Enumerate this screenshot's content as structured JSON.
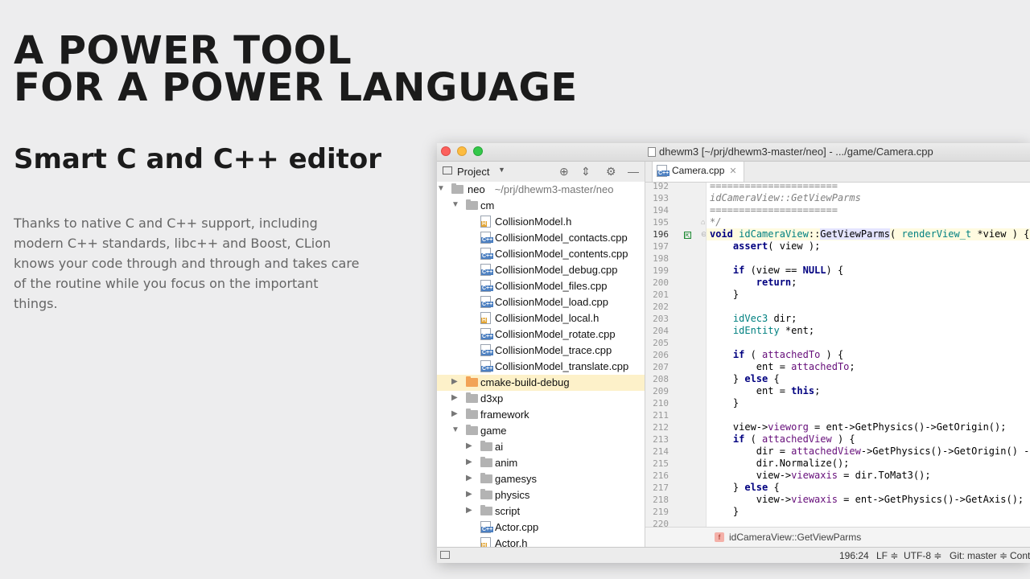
{
  "hero": {
    "line1": "A POWER TOOL",
    "line2": "FOR A POWER LANGUAGE",
    "subtitle": "Smart C and C++ editor",
    "description": "Thanks to native C and C++ support, including modern C++ standards, libc++ and Boost, CLion knows your code through and through and takes care of the routine while you focus on the important things."
  },
  "window": {
    "title": "dhewm3 [~/prj/dhewm3-master/neo] - .../game/Camera.cpp"
  },
  "project_panel": {
    "label": "Project",
    "tools": [
      "target-icon",
      "collapse-icon",
      "gear-icon",
      "minimize-icon"
    ]
  },
  "tree": {
    "root": {
      "name": "neo",
      "path": "~/prj/dhewm3-master/neo"
    },
    "items": [
      {
        "label": "cm",
        "kind": "folder",
        "expanded": true
      },
      {
        "label": "CollisionModel.h",
        "kind": "h"
      },
      {
        "label": "CollisionModel_contacts.cpp",
        "kind": "cpp"
      },
      {
        "label": "CollisionModel_contents.cpp",
        "kind": "cpp"
      },
      {
        "label": "CollisionModel_debug.cpp",
        "kind": "cpp"
      },
      {
        "label": "CollisionModel_files.cpp",
        "kind": "cpp"
      },
      {
        "label": "CollisionModel_load.cpp",
        "kind": "cpp"
      },
      {
        "label": "CollisionModel_local.h",
        "kind": "h"
      },
      {
        "label": "CollisionModel_rotate.cpp",
        "kind": "cpp"
      },
      {
        "label": "CollisionModel_trace.cpp",
        "kind": "cpp"
      },
      {
        "label": "CollisionModel_translate.cpp",
        "kind": "cpp"
      },
      {
        "label": "cmake-build-debug",
        "kind": "folder-orange",
        "selected": true
      },
      {
        "label": "d3xp",
        "kind": "folder"
      },
      {
        "label": "framework",
        "kind": "folder"
      },
      {
        "label": "game",
        "kind": "folder",
        "expanded": true
      },
      {
        "label": "ai",
        "kind": "folder"
      },
      {
        "label": "anim",
        "kind": "folder"
      },
      {
        "label": "gamesys",
        "kind": "folder"
      },
      {
        "label": "physics",
        "kind": "folder"
      },
      {
        "label": "script",
        "kind": "folder"
      },
      {
        "label": "Actor.cpp",
        "kind": "cpp"
      },
      {
        "label": "Actor.h",
        "kind": "h"
      }
    ]
  },
  "editor": {
    "tab_label": "Camera.cpp",
    "tab_close": "✕",
    "line_numbers": [
      "192",
      "193",
      "194",
      "195",
      "196",
      "197",
      "198",
      "199",
      "200",
      "201",
      "202",
      "203",
      "204",
      "205",
      "206",
      "207",
      "208",
      "209",
      "210",
      "211",
      "212",
      "213",
      "214",
      "215",
      "216",
      "217",
      "218",
      "219",
      "220"
    ],
    "current_line": "196",
    "breadcrumb_badge": "f",
    "breadcrumb": "idCameraView::GetViewParms"
  },
  "status": {
    "position": "196:24",
    "line_sep": "LF ≑",
    "encoding": "UTF-8 ≑",
    "vcs": "Git: master ≑",
    "context": "Cont"
  }
}
